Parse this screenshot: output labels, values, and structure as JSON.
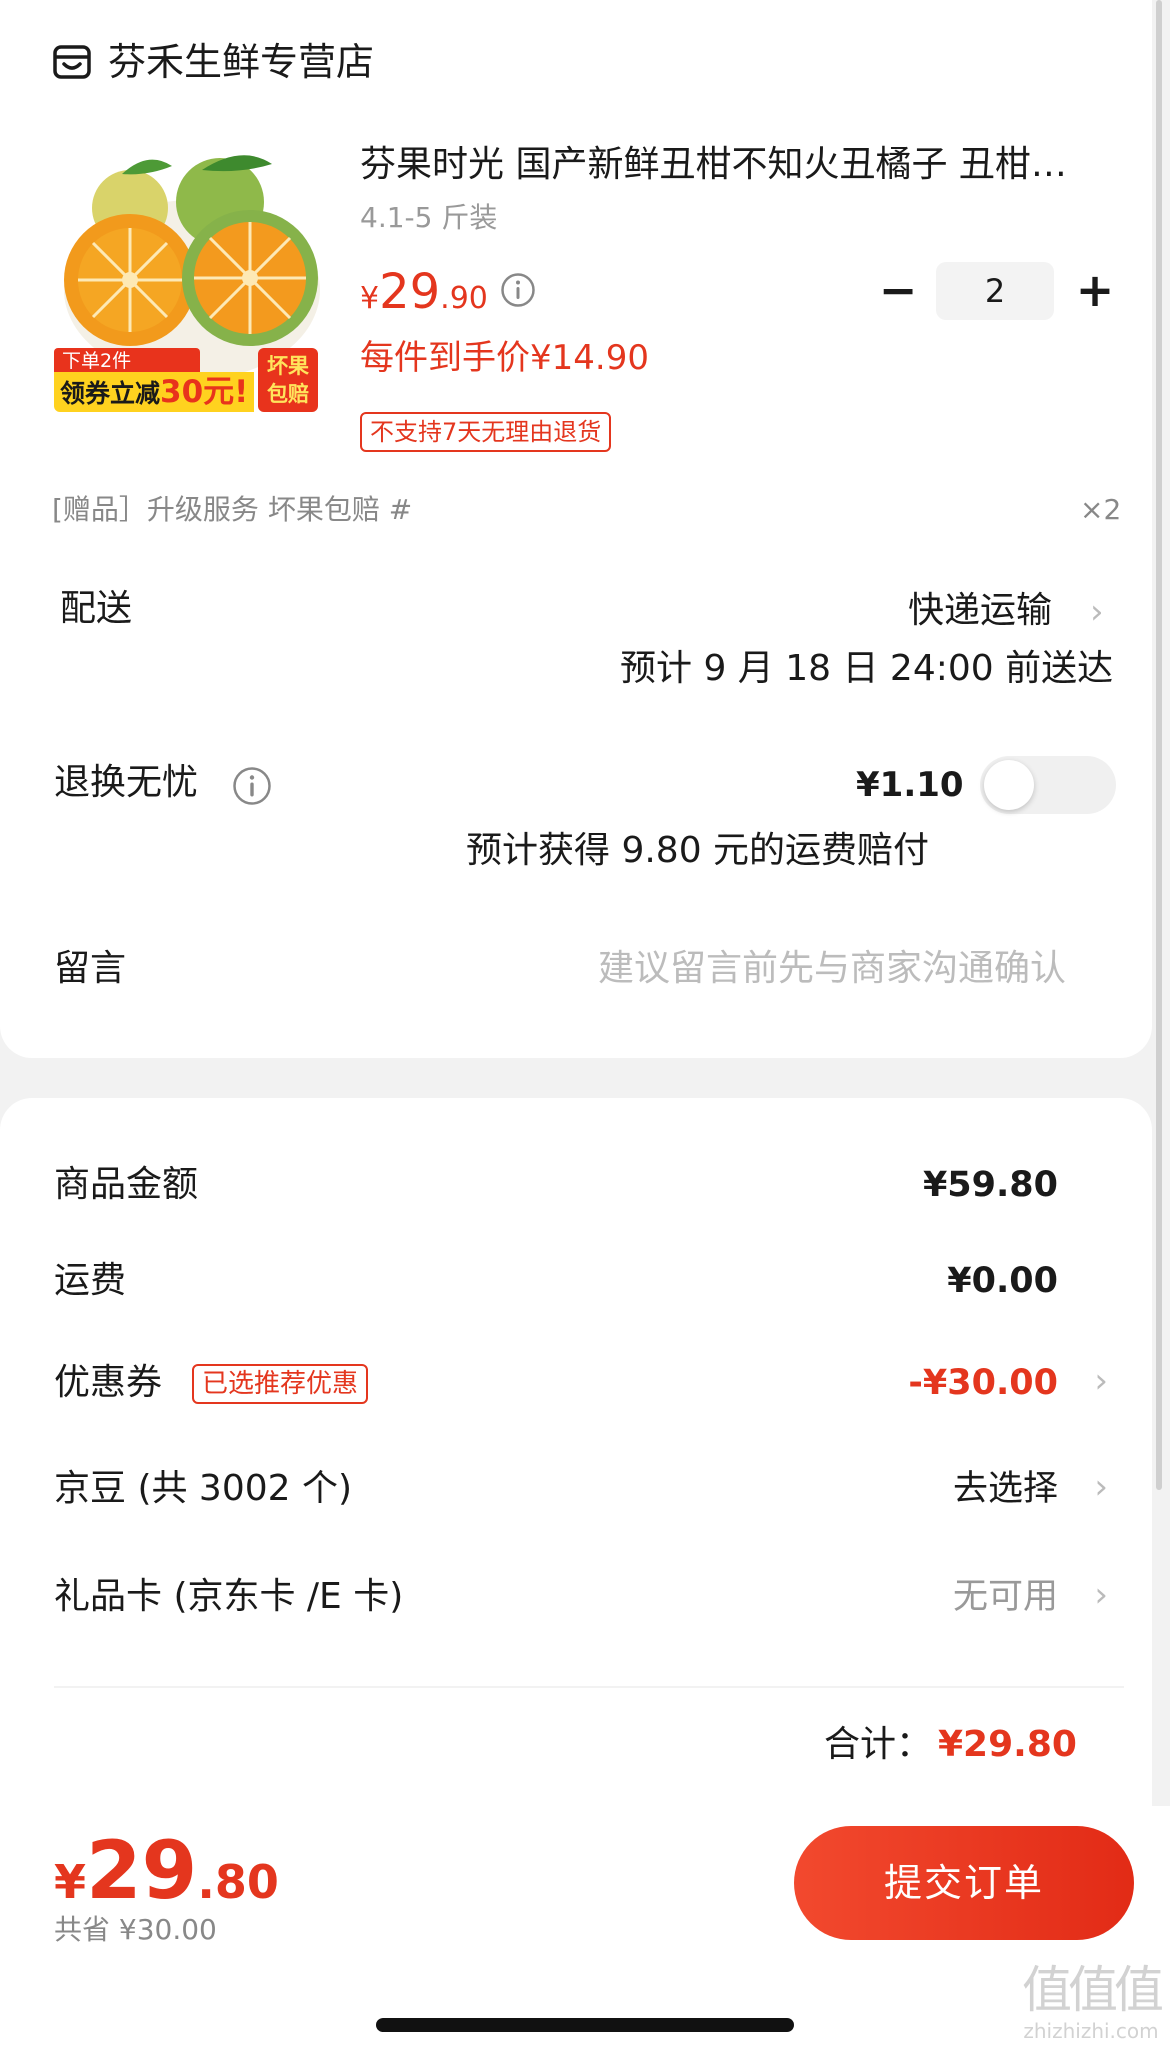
{
  "shop": {
    "name": "芬禾生鲜专营店",
    "icon": "shop-icon"
  },
  "product": {
    "title": "芬果时光 国产新鲜丑柑不知火丑橘子 丑柑不知火丑橘子",
    "spec": "4.1-5 斤装",
    "price": {
      "currency": "¥",
      "integer": "29",
      "decimal": ".90"
    },
    "quantity": "2",
    "unit_price": "每件到手价¥14.90",
    "return_tag": "不支持7天无理由退货",
    "promo": {
      "top": "下单2件",
      "main_prefix": "领券立减",
      "main_amount": "30元!",
      "badge_line1": "坏果",
      "badge_line2": "包赔"
    }
  },
  "gift": {
    "label": "[赠品］升级服务 坏果包赔 #",
    "count": "×2"
  },
  "delivery": {
    "label": "配送",
    "method": "快递运输",
    "eta": "预计 9 月 18 日 24:00 前送达"
  },
  "worry_free": {
    "label": "退换无忧",
    "price": "¥1.10",
    "note": "预计获得 9.80 元的运费赔付",
    "enabled": false
  },
  "memo": {
    "label": "留言",
    "placeholder": "建议留言前先与商家沟通确认",
    "value": ""
  },
  "summary": {
    "goods_label": "商品金额",
    "goods_value": "¥59.80",
    "shipping_label": "运费",
    "shipping_value": "¥0.00",
    "coupon_label": "优惠券",
    "coupon_tag": "已选推荐优惠",
    "coupon_value": "-¥30.00",
    "jingdou_label": "京豆 (共 3002 个)",
    "jingdou_value": "去选择",
    "giftcard_label": "礼品卡 (京东卡 /E 卡)",
    "giftcard_value": "无可用",
    "total_label": "合计：",
    "total_value": "¥29.80"
  },
  "bottom_bar": {
    "price": {
      "currency": "¥",
      "integer": "29",
      "decimal": ".80"
    },
    "saved": "共省 ¥30.00",
    "submit_label": "提交订单"
  },
  "watermark": {
    "mark": "值值值",
    "text": "zhizhizhi.com"
  },
  "colors": {
    "accent": "#e4361e",
    "text": "#1a1a1a",
    "muted": "#999999",
    "background": "#f2f2f2"
  }
}
